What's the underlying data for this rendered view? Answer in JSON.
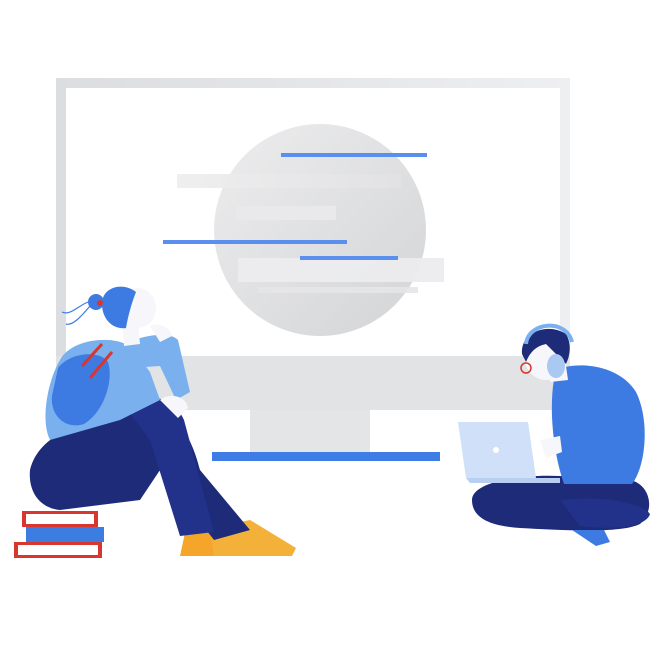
{
  "scene": {
    "subject": "illustration",
    "colors": {
      "background": "#ffffff",
      "monitor_frame": "#e7e8ea",
      "monitor_screen": "#ffffff",
      "monitor_chin": "#e2e3e5",
      "accent_blue": "#4f86ec",
      "navy": "#1e2b78",
      "shirt_light_blue": "#7ab0ee",
      "shirt_blue": "#3d7be3",
      "skin": "#f7f7fb",
      "shoe_orange": "#f4a52a",
      "book_red": "#d8362f",
      "book_blue": "#3b7de0",
      "laptop": "#cfe0f8"
    },
    "icons": [
      "monitor-icon",
      "woman-figure",
      "man-figure",
      "laptop-icon",
      "books-icon",
      "headphones-icon"
    ]
  }
}
